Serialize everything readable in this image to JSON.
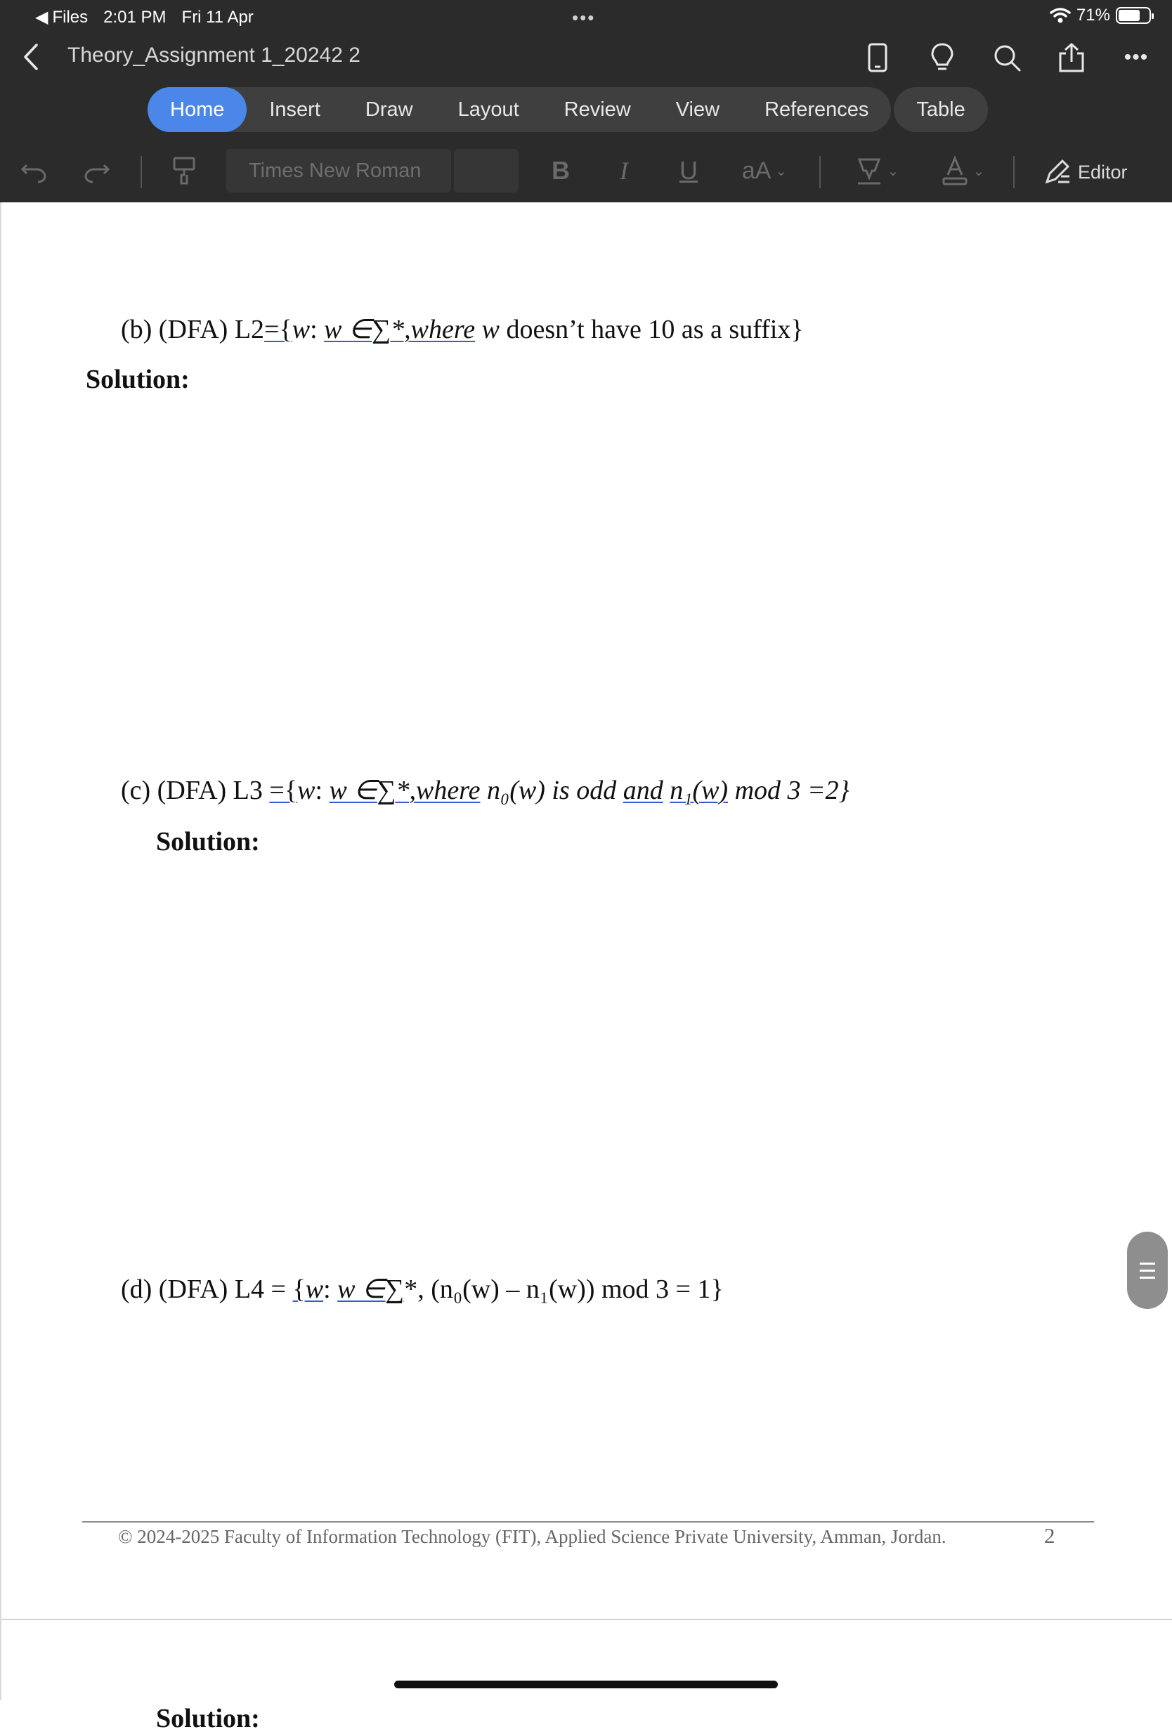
{
  "status_bar": {
    "back_app": "Files",
    "time": "2:01 PM",
    "date": "Fri 11 Apr",
    "battery": "71%",
    "battery_level": 0.71
  },
  "title_bar": {
    "document_title": "Theory_Assignment 1_20242 2"
  },
  "tabs": [
    {
      "label": "Home",
      "active": true
    },
    {
      "label": "Insert",
      "active": false
    },
    {
      "label": "Draw",
      "active": false
    },
    {
      "label": "Layout",
      "active": false
    },
    {
      "label": "Review",
      "active": false
    },
    {
      "label": "View",
      "active": false
    },
    {
      "label": "References",
      "active": false
    }
  ],
  "context_tab": {
    "label": "Table"
  },
  "toolbar": {
    "font_name": "Times New Roman",
    "bold": "B",
    "italic": "I",
    "underline": "U",
    "text_size": "aA",
    "editor": "Editor"
  },
  "document": {
    "q_b": {
      "prefix": "(b) (DFA) L2",
      "set_open": "={",
      "var": "w",
      "colon": ":",
      "member": "w ∈∑*,where",
      "var2": "w",
      "rest": "doesn’t have 10 as a suffix}"
    },
    "solution_label": "Solution:",
    "q_c": {
      "prefix": "(c) (DFA) L3 ",
      "set_open": "={",
      "var": "w",
      "colon": ":",
      "member": "w ∈∑*,where",
      "cond1": "n₀(w) is odd",
      "and": "and",
      "cond2": "n₁(w)",
      "rest": "mod 3 =2}"
    },
    "q_d": {
      "prefix": "(d) (DFA) L4 = ",
      "set_open": "{",
      "var": "w",
      "colon": ":",
      "member": "w ∈∑",
      "rest": "*, (n₀(w) – n₁(w)) mod 3 = 1}"
    },
    "footer": "© 2024-2025 Faculty of Information Technology (FIT), Applied Science Private University, Amman, Jordan.",
    "page_number": "2"
  },
  "colors": {
    "chrome_bg": "#2b2b2b",
    "active_tab": "#4a87e8",
    "underline": "#3a5bd0"
  },
  "icons": [
    "chevron-back-icon",
    "phone-view-icon",
    "lightbulb-icon",
    "search-icon",
    "share-icon",
    "more-icon",
    "undo-icon",
    "redo-icon",
    "format-painter-icon",
    "highlighter-icon",
    "font-color-icon",
    "editor-pen-icon",
    "wifi-icon"
  ]
}
